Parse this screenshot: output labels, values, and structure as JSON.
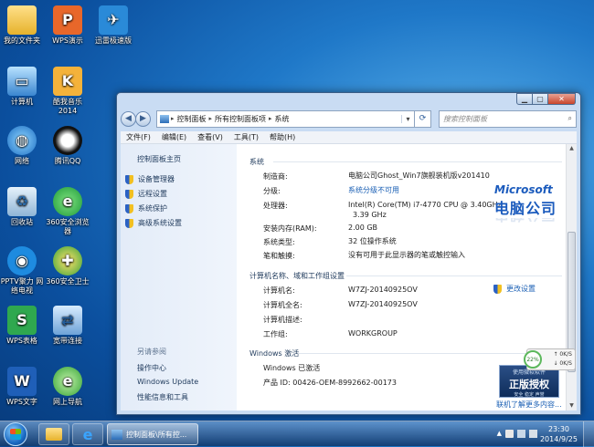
{
  "desktop": {
    "icons": [
      {
        "label": "我的文件夹",
        "icon": "folder-icon"
      },
      {
        "label": "WPS演示",
        "icon": "wps-presentation-icon"
      },
      {
        "label": "迅雷极速版",
        "icon": "thunder-bird-icon"
      },
      {
        "label": "计算机",
        "icon": "computer-icon"
      },
      {
        "label": "酷我音乐 2014",
        "icon": "kuwo-music-icon"
      },
      {
        "label": "网络",
        "icon": "network-icon"
      },
      {
        "label": "腾讯QQ",
        "icon": "qq-penguin-icon"
      },
      {
        "label": "回收站",
        "icon": "recycle-bin-icon"
      },
      {
        "label": "360安全浏览器",
        "icon": "360-browser-icon"
      },
      {
        "label": "PPTV聚力 网络电视",
        "icon": "pptv-icon"
      },
      {
        "label": "360安全卫士",
        "icon": "360-safe-icon"
      },
      {
        "label": "WPS表格",
        "icon": "wps-spreadsheet-icon"
      },
      {
        "label": "宽带连接",
        "icon": "broadband-icon"
      },
      {
        "label": "WPS文字",
        "icon": "wps-writer-icon"
      },
      {
        "label": "网上导航",
        "icon": "web-nav-icon"
      }
    ]
  },
  "window": {
    "breadcrumb": [
      "控制面板",
      "所有控制面板项",
      "系统"
    ],
    "search_placeholder": "搜索控制面板",
    "menu": [
      "文件(F)",
      "编辑(E)",
      "查看(V)",
      "工具(T)",
      "帮助(H)"
    ],
    "left_pane": {
      "home": "控制面板主页",
      "links": [
        "设备管理器",
        "远程设置",
        "系统保护",
        "高级系统设置"
      ],
      "see_also_title": "另请参阅",
      "see_also": [
        "操作中心",
        "Windows Update",
        "性能信息和工具"
      ]
    },
    "system": {
      "section_title": "系统",
      "rows": [
        {
          "label": "制造商:",
          "value": "电脑公司Ghost_Win7旗舰装机版v201410"
        },
        {
          "label": "分级:",
          "value": "系统分级不可用"
        },
        {
          "label": "处理器:",
          "value": "Intel(R) Core(TM) i7-4770 CPU @ 3.40GHz",
          "value2": "3.39 GHz"
        },
        {
          "label": "安装内存(RAM):",
          "value": "2.00 GB"
        },
        {
          "label": "系统类型:",
          "value": "32 位操作系统"
        },
        {
          "label": "笔和触摸:",
          "value": "没有可用于此显示器的笔或触控输入"
        }
      ]
    },
    "logo": {
      "line1": "Microsoft",
      "line2": "电脑公司"
    },
    "computer": {
      "section_title": "计算机名称、域和工作组设置",
      "rows": [
        {
          "label": "计算机名:",
          "value": "W7ZJ-20140925OV"
        },
        {
          "label": "计算机全名:",
          "value": "W7ZJ-20140925OV"
        },
        {
          "label": "计算机描述:",
          "value": ""
        },
        {
          "label": "工作组:",
          "value": "WORKGROUP"
        }
      ],
      "change_settings": "更改设置"
    },
    "activation": {
      "section_title": "Windows 激活",
      "status": "Windows 已激活",
      "product_id": "产品 ID: 00426-OEM-8992662-00173",
      "badge_top": "使用微软软件",
      "badge_main": "正版授权",
      "badge_bottom": "安全 稳定 声誉",
      "more_info": "联机了解更多内容..."
    }
  },
  "net_widget": {
    "percent": "22%",
    "up": "0K/S",
    "down": "0K/S"
  },
  "taskbar": {
    "task_label": "控制面板\\所有控...",
    "time": "23:30",
    "date": "2014/9/25"
  }
}
